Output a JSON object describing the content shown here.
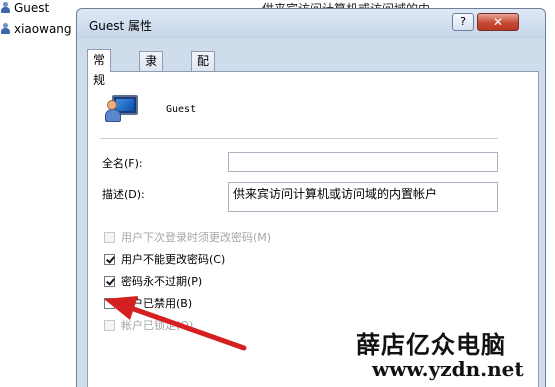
{
  "background_list": {
    "items": [
      {
        "label": "Guest"
      },
      {
        "label": "xiaowang"
      }
    ],
    "description_snippet": "供来宾访问计算机或访问域的内..."
  },
  "dialog": {
    "title": "Guest 属性",
    "help_label": "?",
    "close_label": "✕",
    "tabs": [
      {
        "label": "常规",
        "active": true
      },
      {
        "label": "隶属于",
        "active": false
      },
      {
        "label": "配置文件",
        "active": false
      }
    ],
    "user_name": "Guest",
    "fields": {
      "fullname_label": "全名(F):",
      "fullname_value": "",
      "description_label": "描述(D):",
      "description_value": "供来宾访问计算机或访问域的内置帐户"
    },
    "options": [
      {
        "label": "用户下次登录时须更改密码(M)",
        "checked": false,
        "disabled": true
      },
      {
        "label": "用户不能更改密码(C)",
        "checked": true,
        "disabled": false
      },
      {
        "label": "密码永不过期(P)",
        "checked": true,
        "disabled": false
      },
      {
        "label": "帐户已禁用(B)",
        "checked": false,
        "disabled": false
      },
      {
        "label": "帐户已锁定(O)",
        "checked": false,
        "disabled": true
      }
    ]
  },
  "watermark": {
    "title": "薛店亿众电脑",
    "url": "www.yzdn.net"
  },
  "colors": {
    "annotation_arrow": "#d42020",
    "dialog_frame": "#cfdcec",
    "close_button": "#c74a35"
  }
}
